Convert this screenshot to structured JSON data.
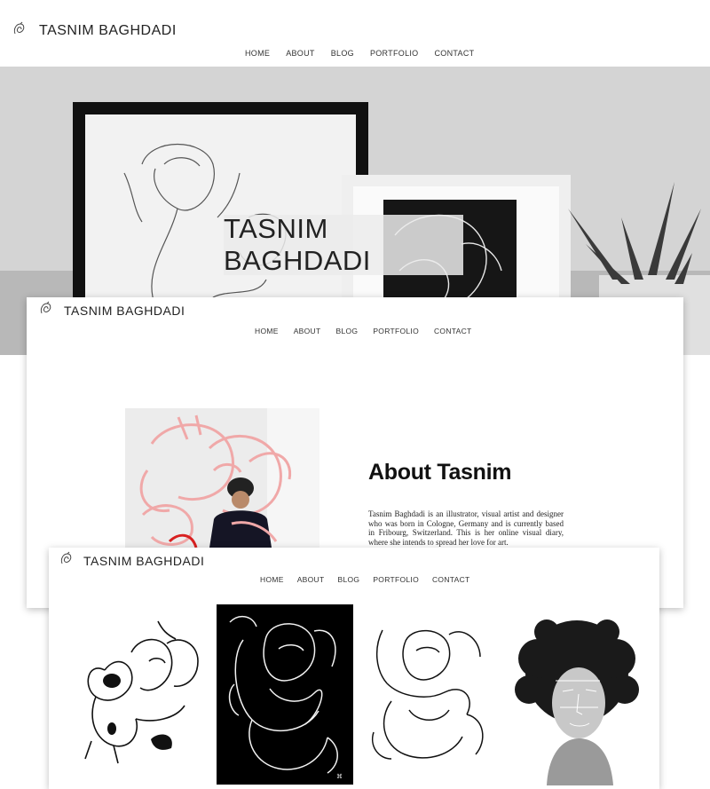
{
  "brand": {
    "name": "TASNIM BAGHDADI"
  },
  "nav": {
    "home": "HOME",
    "about": "ABOUT",
    "blog": "BLOG",
    "portfolio": "PORTFOLIO",
    "contact": "CONTACT"
  },
  "hero": {
    "title": "TASNIM BAGHDADI"
  },
  "about": {
    "title": "About Tasnim",
    "text": "Tasnim Baghdadi is an illustrator, visual artist and designer who was born in Cologne, Germany and is currently based in Fribourg, Switzerland. This is her online visual diary, where she intends to spread her love for art."
  },
  "portfolio": {
    "items": [
      {
        "name": "line-art-figure-white"
      },
      {
        "name": "line-art-figure-black"
      },
      {
        "name": "line-art-embrace-white"
      },
      {
        "name": "curly-hair-portrait-photo"
      }
    ]
  },
  "colors": {
    "text": "#222222",
    "hero_overlay": "#ebebeb",
    "accent_pink": "#f0a8a8",
    "accent_red": "#d82020"
  }
}
